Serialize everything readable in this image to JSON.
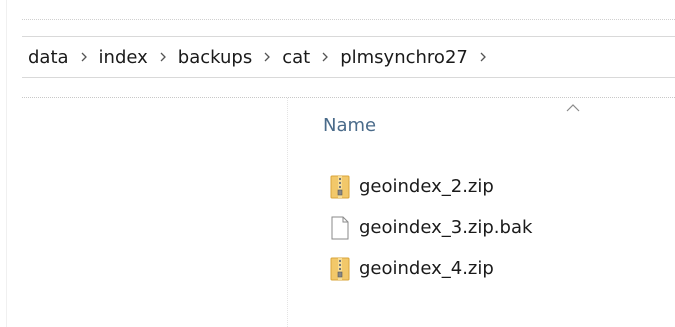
{
  "breadcrumb": {
    "items": [
      {
        "label": "data"
      },
      {
        "label": "index"
      },
      {
        "label": "backups"
      },
      {
        "label": "cat"
      },
      {
        "label": "plmsynchro27"
      }
    ]
  },
  "file_list": {
    "column_header": "Name",
    "sort": "ascending",
    "files": [
      {
        "name": "geoindex_2.zip",
        "icon": "zip-folder-icon"
      },
      {
        "name": "geoindex_3.zip.bak",
        "icon": "blank-file-icon"
      },
      {
        "name": "geoindex_4.zip",
        "icon": "zip-folder-icon"
      }
    ]
  },
  "colors": {
    "header_text": "#4a6b8a",
    "folder_yellow": "#e8b84a",
    "text": "#1a1a1a"
  }
}
